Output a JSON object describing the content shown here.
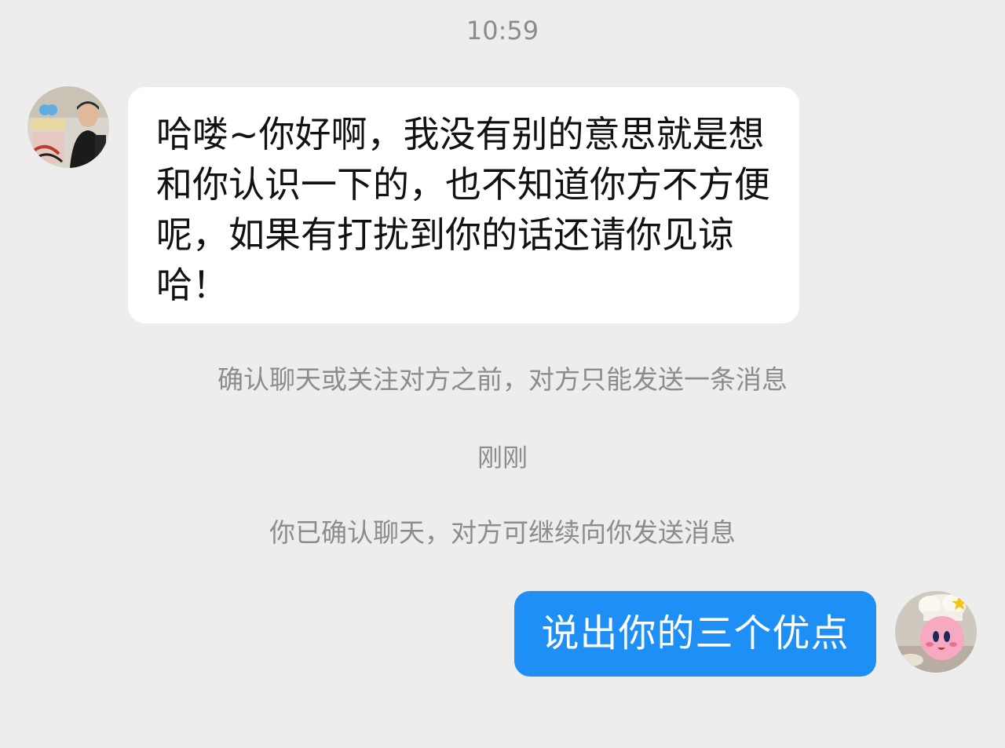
{
  "header": {
    "time": "10:59"
  },
  "messages": {
    "incoming": {
      "text": "哈喽~你好啊，我没有别的意思就是想和你认识一下的，也不知道你方不方便呢，如果有打扰到你的话还请你见谅哈！"
    },
    "system_notice_1": "确认聊天或关注对方之前，对方只能发送一条消息",
    "time_label": "刚刚",
    "system_notice_2": "你已确认聊天，对方可继续向你发送消息",
    "outgoing": {
      "text": "说出你的三个优点"
    }
  },
  "colors": {
    "background": "#ededed",
    "incoming_bubble": "#ffffff",
    "outgoing_bubble": "#1e8ff5",
    "system_text": "#8c8c8c"
  },
  "icons": {
    "left_avatar": "contact-avatar-photo",
    "right_avatar": "own-avatar-photo"
  }
}
